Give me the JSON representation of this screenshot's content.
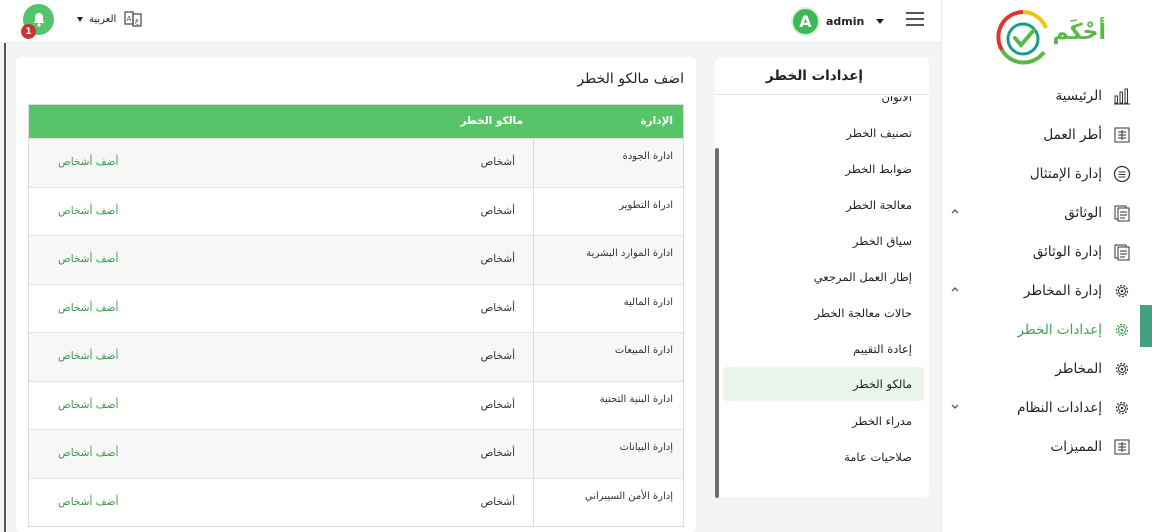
{
  "header": {
    "username": "admin",
    "avatar_letter": "A",
    "language": "العربية",
    "notification_count": "1"
  },
  "logo": {
    "text": "أحْكَم"
  },
  "sidebar": {
    "items": [
      {
        "label": "الرئيسية",
        "icon": "chart-bars-icon"
      },
      {
        "label": "أطر العمل",
        "icon": "document-grid-icon"
      },
      {
        "label": "إدارة الإمتثال",
        "icon": "list-circle-icon"
      },
      {
        "label": "الوثائق",
        "icon": "documents-icon"
      },
      {
        "label": "إدارة الوثائق",
        "icon": "documents-icon"
      },
      {
        "label": "إدارة المخاطر",
        "icon": "gear-icon"
      },
      {
        "label": "إعدادات الخطر",
        "icon": "gear-icon"
      },
      {
        "label": "المخاطر",
        "icon": "gear-icon"
      },
      {
        "label": "إعدادات النظام",
        "icon": "gear-icon"
      },
      {
        "label": "المميزات",
        "icon": "document-grid-icon"
      }
    ]
  },
  "settings": {
    "title": "إعدادات الخطر",
    "items": [
      "الأثوان",
      "تصنيف الخطر",
      "ضوابط الخطر",
      "معالجة الخطر",
      "سياق الخطر",
      "إطار العمل المرجعي",
      "حالات معالجة الخطر",
      "إعادة التقييم",
      "مالكو الخطر",
      "مدراء الخطر",
      "صلاحيات عامة"
    ],
    "active_index": 8
  },
  "main": {
    "title": "اضف مالكو الخطر",
    "table": {
      "headers": {
        "department": "الإدارة",
        "owners": "مالكو الخطر"
      },
      "persons_label": "أشخاص",
      "add_label": "أضف أشخاص",
      "rows": [
        "ادارة الجودة",
        "ادراة التطوير",
        "ادارة الموارد البشرية",
        "ادارة المالية",
        "ادارة المبيعات",
        "ادارة البنية التحتية",
        "إدارة البيانات",
        "إدارة الأمن السيبراني"
      ]
    }
  },
  "colors": {
    "primary_green": "#58c469",
    "link_green": "#3d9a4a",
    "badge_red": "#c8352f",
    "active_bg": "#e9f5ea"
  }
}
